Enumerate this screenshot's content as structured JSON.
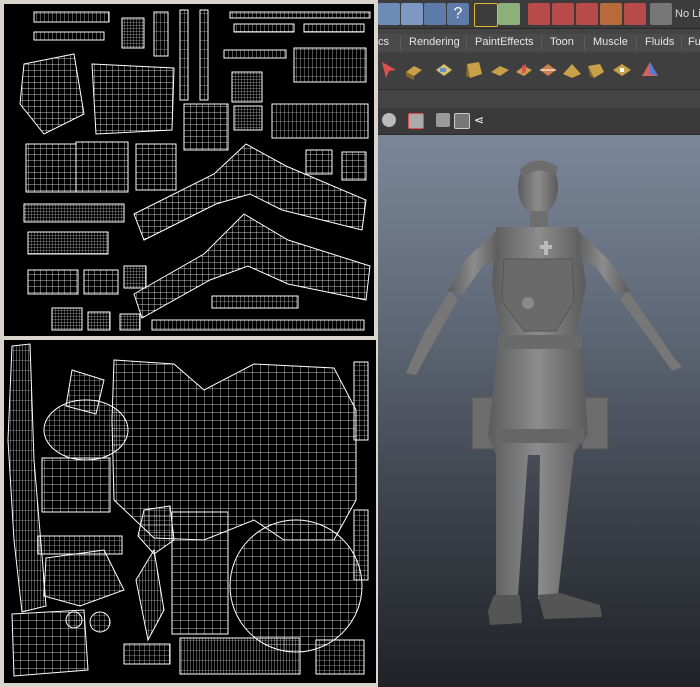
{
  "maya": {
    "toolbar": {
      "no_lights_label": "No Li"
    },
    "shelf_tabs": [
      {
        "label": "cs"
      },
      {
        "label": "Rendering"
      },
      {
        "label": "PaintEffects"
      },
      {
        "label": "Toon"
      },
      {
        "label": "Muscle"
      },
      {
        "label": "Fluids"
      },
      {
        "label": "Fu"
      }
    ]
  },
  "colors": {
    "uv_background": "#000000",
    "uv_wire": "#ffffff",
    "panel_border": "#d9d4cc",
    "viewport_top": "#7b8799",
    "viewport_bottom": "#202226",
    "model_gray": "#7a7a7a"
  }
}
